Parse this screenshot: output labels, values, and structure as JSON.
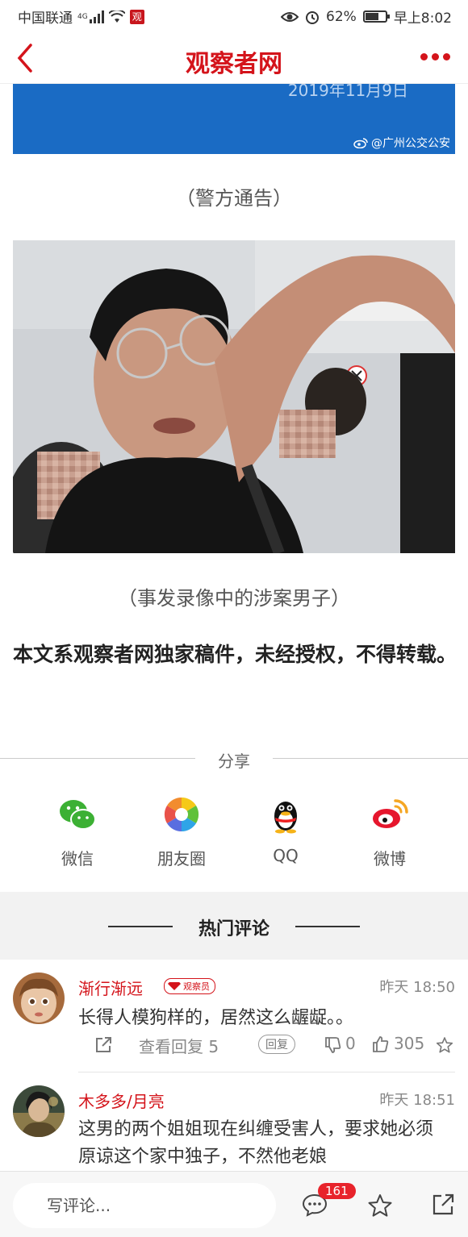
{
  "status_bar": {
    "carrier": "中国联通",
    "network": "4G",
    "app_badge": "观",
    "battery": "62%",
    "battery_level": 0.62,
    "time": "早上8:02"
  },
  "header": {
    "title": "观察者网"
  },
  "article": {
    "notice_image": {
      "date_text": "2019年11月9日",
      "watermark": "@广州公交公安"
    },
    "notice_caption": "（警方通告）",
    "photo_caption": "（事发录像中的涉案男子）",
    "copyright_notice": "本文系观察者网独家稿件，未经授权，不得转载。"
  },
  "share": {
    "title": "分享",
    "items": [
      {
        "label": "微信",
        "icon": "wechat-icon"
      },
      {
        "label": "朋友圈",
        "icon": "moments-icon"
      },
      {
        "label": "QQ",
        "icon": "qq-icon"
      },
      {
        "label": "微博",
        "icon": "weibo-icon"
      }
    ]
  },
  "comments": {
    "section_title": "热门评论",
    "items": [
      {
        "user": "渐行渐远",
        "badge": "观察员",
        "time": "昨天 18:50",
        "text": "长得人模狗样的，居然这么龌龊。。",
        "view_replies": "查看回复 5",
        "reply_label": "回复",
        "dislikes": "0",
        "likes": "305"
      },
      {
        "user": "木多多/月亮",
        "time": "昨天 18:51",
        "text": "这男的两个姐姐现在纠缠受害人，要求她必须原谅这个家中独子，不然他老娘"
      }
    ]
  },
  "bottom_bar": {
    "comment_placeholder": "写评论...",
    "comment_count": "161"
  },
  "colors": {
    "brand_red": "#d4141b",
    "notice_blue": "#1a6bc4"
  }
}
